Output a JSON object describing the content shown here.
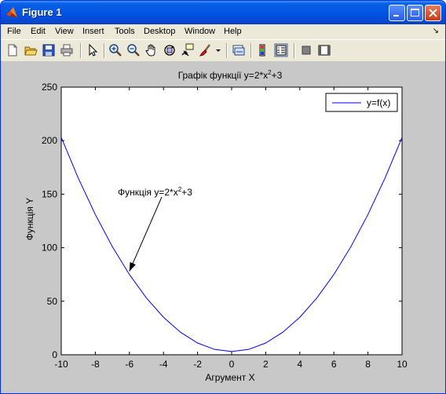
{
  "window": {
    "title": "Figure 1",
    "minimize_icon": "minimize-icon",
    "maximize_icon": "maximize-icon",
    "close_icon": "close-icon"
  },
  "menu": {
    "items": [
      "File",
      "Edit",
      "View",
      "Insert",
      "Tools",
      "Desktop",
      "Window",
      "Help"
    ],
    "dock_icon": "undock-arrow-icon"
  },
  "toolbar": {
    "tools": [
      "new-figure-icon",
      "open-file-icon",
      "save-icon",
      "print-icon",
      "edit-plot-arrow-icon",
      "zoom-in-icon",
      "zoom-out-icon",
      "pan-hand-icon",
      "rotate-3d-icon",
      "data-cursor-icon",
      "brush-icon",
      "brush-dropdown-icon",
      "link-plot-icon",
      "colorbar-icon",
      "legend-icon",
      "hide-plot-tools-icon",
      "show-plot-tools-icon"
    ]
  },
  "chart_data": {
    "type": "line",
    "title_prefix": "Графік функції y=2*x",
    "title_sup": "2",
    "title_suffix": "+3",
    "xlabel": "Агрумент X",
    "ylabel": "Функція Y",
    "xlim": [
      -10,
      10
    ],
    "ylim": [
      0,
      250
    ],
    "xticks": [
      "-10",
      "-8",
      "-6",
      "-4",
      "-2",
      "0",
      "2",
      "4",
      "6",
      "8",
      "10"
    ],
    "yticks": [
      "0",
      "50",
      "100",
      "150",
      "200",
      "250"
    ],
    "x": [
      -10,
      -9,
      -8,
      -7,
      -6,
      -5,
      -4,
      -3,
      -2,
      -1,
      0,
      1,
      2,
      3,
      4,
      5,
      6,
      7,
      8,
      9,
      10
    ],
    "series": [
      {
        "name": "y=f(x)",
        "color": "#0000ff",
        "values": [
          203,
          165,
          131,
          101,
          75,
          53,
          35,
          21,
          11,
          5,
          3,
          5,
          11,
          21,
          35,
          53,
          75,
          101,
          131,
          165,
          203
        ]
      }
    ],
    "annotation": {
      "text_prefix": "Функція y=2*x",
      "text_sup": "2",
      "text_suffix": "+3",
      "arrow_to": [
        -6,
        78
      ]
    },
    "legend_position": "top-right",
    "grid": false
  }
}
